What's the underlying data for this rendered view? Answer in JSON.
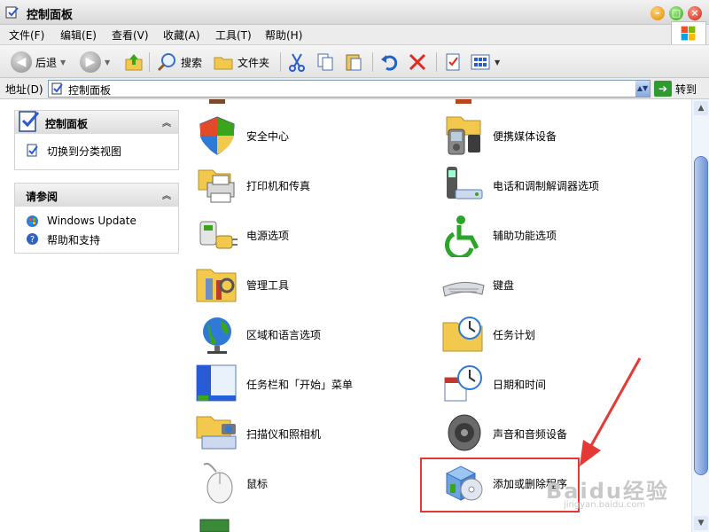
{
  "window": {
    "title": "控制面板",
    "min_label": "–",
    "max_label": "□",
    "close_label": "×"
  },
  "menu": [
    "文件(F)",
    "编辑(E)",
    "查看(V)",
    "收藏(A)",
    "工具(T)",
    "帮助(H)"
  ],
  "toolbar": {
    "back_label": "后退",
    "search_label": "搜索",
    "folders_label": "文件夹"
  },
  "address": {
    "label": "地址(D)",
    "value": "控制面板",
    "go_label": "转到"
  },
  "left_panels": {
    "control": {
      "title": "控制面板",
      "switch_label": "切换到分类视图"
    },
    "seealso": {
      "title": "请参阅",
      "windows_update": "Windows Update",
      "help_support": "帮助和支持"
    }
  },
  "items_left": [
    "安全中心",
    "打印机和传真",
    "电源选项",
    "管理工具",
    "区域和语言选项",
    "任务栏和「开始」菜单",
    "扫描仪和照相机",
    "鼠标"
  ],
  "items_right": [
    "便携媒体设备",
    "电话和调制解调器选项",
    "辅助功能选项",
    "键盘",
    "任务计划",
    "日期和时间",
    "声音和音频设备",
    "添加或删除程序"
  ],
  "watermark": {
    "text": "Baidu经验",
    "sub": "jingyan.baidu.com"
  }
}
